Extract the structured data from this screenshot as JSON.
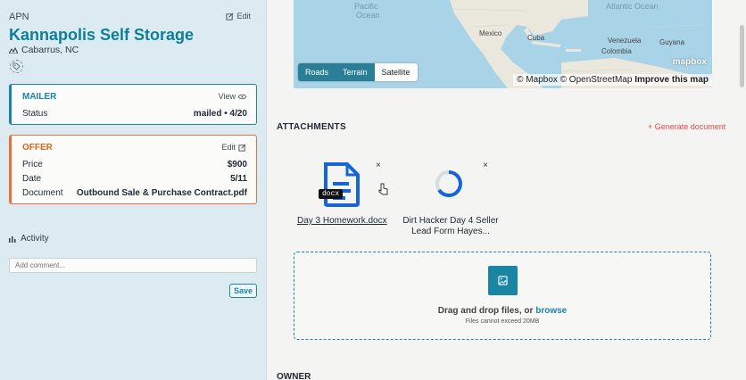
{
  "property": {
    "apn_label": "APN",
    "edit_label": "Edit",
    "title": "Kannapolis Self Storage",
    "location": "Cabarrus, NC"
  },
  "mailer": {
    "heading": "MAILER",
    "action_label": "View",
    "status_label": "Status",
    "status_value": "mailed • 4/20"
  },
  "offer": {
    "heading": "OFFER",
    "action_label": "Edit",
    "price_label": "Price",
    "price_value": "$900",
    "date_label": "Date",
    "date_value": "5/11",
    "document_label": "Document",
    "document_value": "Outbound Sale & Purchase Contract.pdf"
  },
  "activity": {
    "heading": "Activity",
    "comment_placeholder": "Add comment...",
    "save_label": "Save"
  },
  "map": {
    "controls": [
      "Roads",
      "Terrain",
      "Satellite"
    ],
    "active_control": "Satellite",
    "labels": {
      "pacific": "Pacific\nOcean",
      "atlantic": "Atlantic Ocean",
      "mexico": "Mexico",
      "cuba": "Cuba",
      "venezuela": "Venezuela",
      "colombia": "Colombia",
      "guyana": "Guyana"
    },
    "attribution": "© Mapbox © OpenStreetMap",
    "improve_label": "Improve this map",
    "logo_text": "mapbox"
  },
  "attachments": {
    "heading": "ATTACHMENTS",
    "generate_label": "+ Generate document",
    "files": [
      {
        "name": "Day 3 Homework.docx",
        "badge": "docx"
      },
      {
        "name": "Dirt Hacker Day 4 Seller Lead Form Hayes..."
      }
    ],
    "dropzone": {
      "text": "Drag and drop files, or",
      "browse": "browse",
      "subtext": "Files cannot exceed 20MB"
    }
  },
  "owner": {
    "heading": "OWNER"
  },
  "colors": {
    "accent": "#1a86a3",
    "offer": "#e5621f",
    "danger": "#e14b4b",
    "sidebar_bg": "#dcebf2"
  }
}
